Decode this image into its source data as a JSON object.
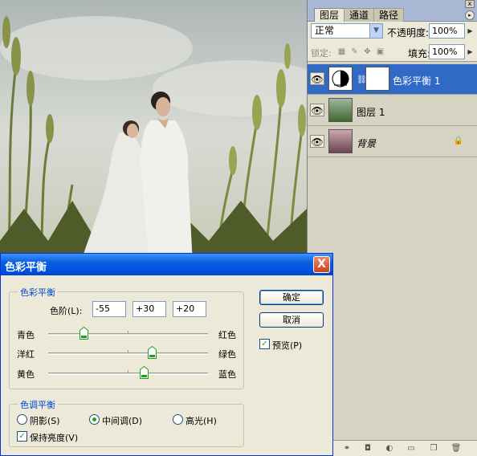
{
  "panel": {
    "tabs": [
      "图层",
      "通道",
      "路径"
    ],
    "active_tab": "图层",
    "close": "x",
    "menu": "▸",
    "blend_mode": "正常",
    "opacity_label": "不透明度:",
    "opacity_value": "100%",
    "lock_label": "锁定:",
    "fill_label": "填充:",
    "fill_value": "100%",
    "layers": [
      {
        "name": "色彩平衡 1",
        "selected": true
      },
      {
        "name": "图层 1",
        "selected": false
      },
      {
        "name": "背景",
        "selected": false
      }
    ]
  },
  "dialog": {
    "title": "色彩平衡",
    "close": "X",
    "color_group": "色彩平衡",
    "levels_label": "色阶(L):",
    "levels": [
      "-55",
      "+30",
      "+20"
    ],
    "sliders": [
      {
        "left": "青色",
        "right": "红色",
        "value": -55
      },
      {
        "left": "洋红",
        "right": "绿色",
        "value": 30
      },
      {
        "left": "黄色",
        "right": "蓝色",
        "value": 20
      }
    ],
    "tone_group": "色调平衡",
    "tones": [
      "阴影(S)",
      "中间调(D)",
      "高光(H)"
    ],
    "selected_tone": "中间调(D)",
    "preserve_luminosity": "保持亮度(V)",
    "preserve_checked": true,
    "ok": "确定",
    "cancel": "取消",
    "preview": "预览(P)",
    "preview_checked": true
  }
}
